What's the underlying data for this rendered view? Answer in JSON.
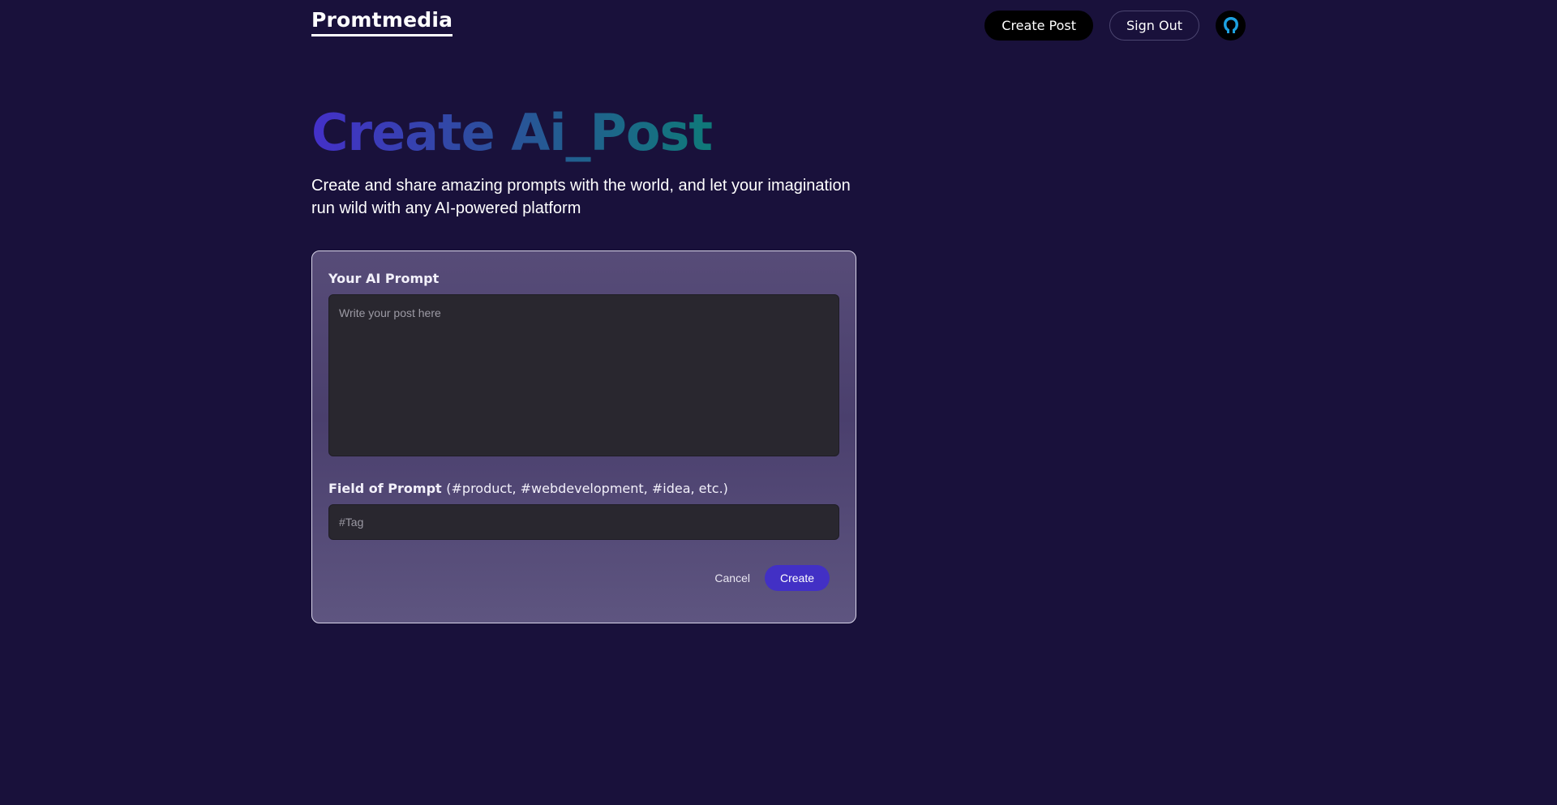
{
  "nav": {
    "logo": "Promtmedia",
    "create_post_label": "Create Post",
    "sign_out_label": "Sign Out",
    "avatar_icon": "user-avatar-icon"
  },
  "hero": {
    "title": "Create Ai_Post",
    "subtitle": "Create and share amazing prompts with the world, and let your imagination run wild with any AI-powered platform",
    "title_gradient": [
      "#4430c9",
      "#2c4f9c",
      "#0f7a79"
    ]
  },
  "form": {
    "prompt_label": "Your AI Prompt",
    "prompt_value": "",
    "prompt_placeholder": "Write your post here",
    "tag_label_bold": "Field of Prompt",
    "tag_label_light": "(#product, #webdevelopment, #idea, etc.)",
    "tag_value": "",
    "tag_placeholder": "#Tag",
    "cancel_label": "Cancel",
    "create_label": "Create"
  },
  "colors": {
    "background": "#19113b",
    "accent": "#4230c5",
    "input_bg": "#29272f"
  }
}
